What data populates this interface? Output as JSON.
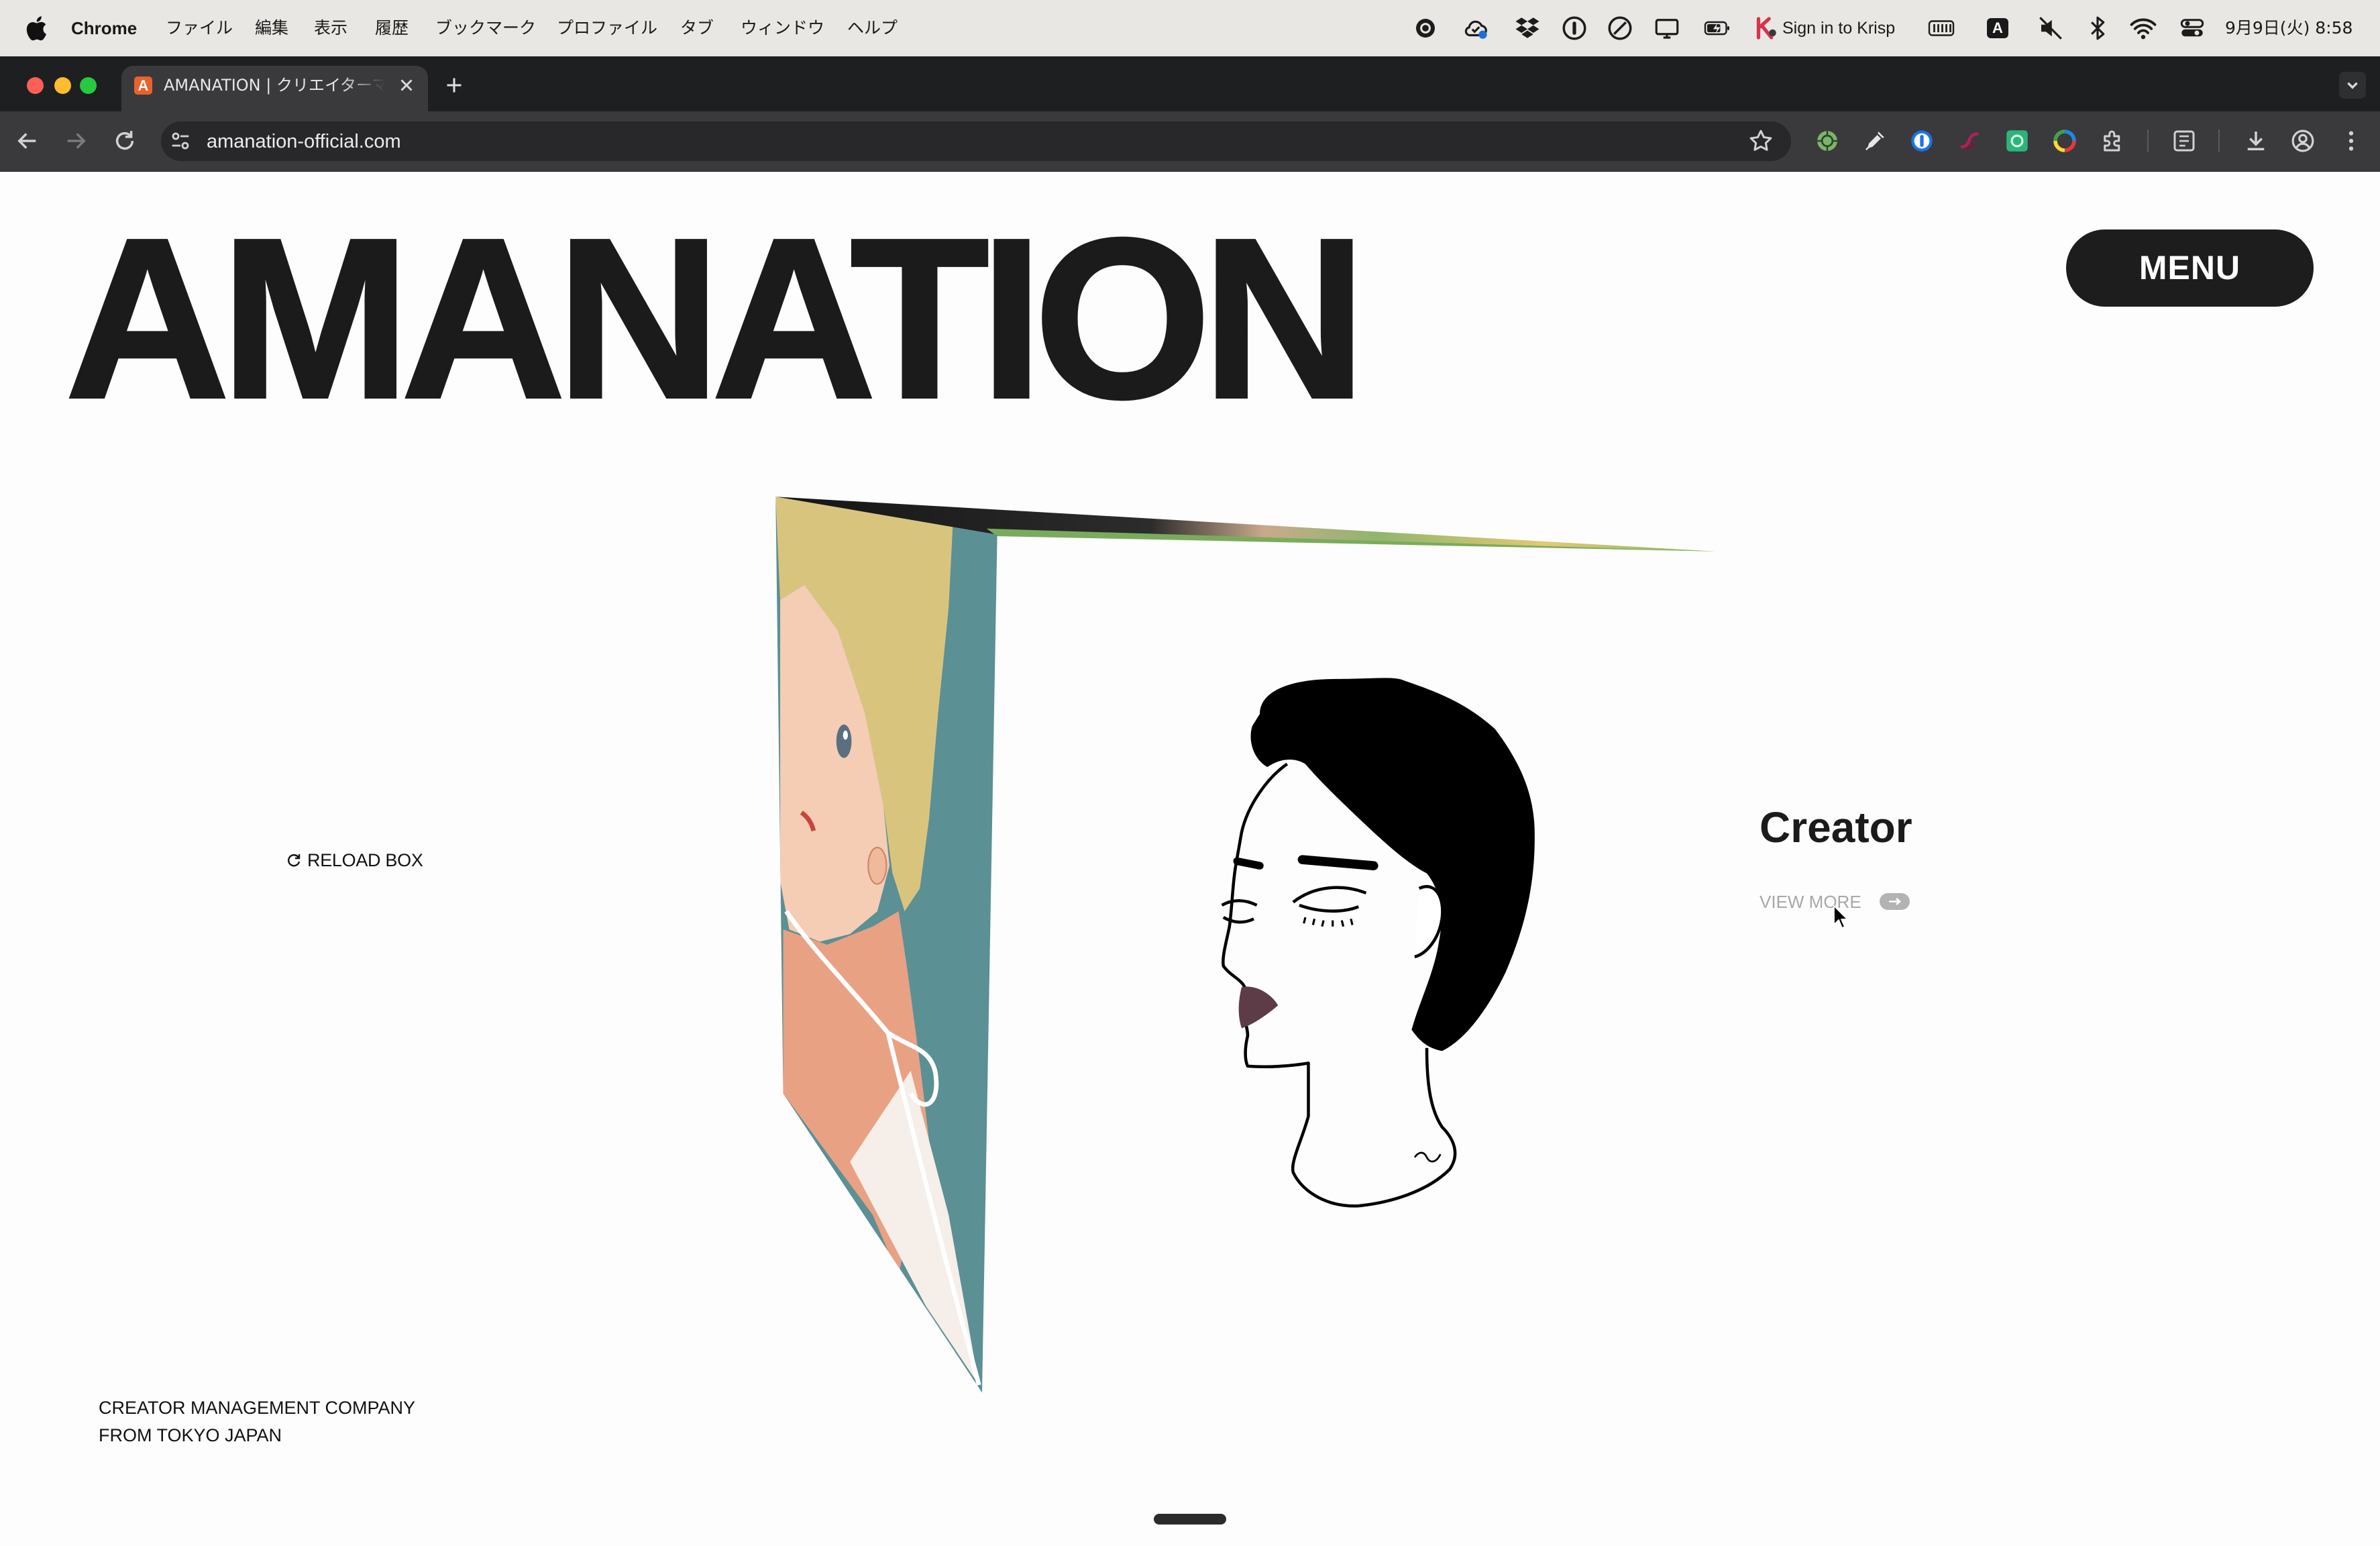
{
  "menubar": {
    "app_name": "Chrome",
    "items": [
      "ファイル",
      "編集",
      "表示",
      "履歴",
      "ブックマーク",
      "プロファイル",
      "タブ",
      "ウィンドウ",
      "ヘルプ"
    ],
    "krisp_label": "Sign in to Krisp",
    "input_source": "A",
    "clock": "9月9日(火) 8:58",
    "status_icons": [
      "screen-record-icon",
      "cloud-sync-icon",
      "dropbox-icon",
      "password-manager-icon",
      "focus-icon",
      "display-icon",
      "battery-charging-icon",
      "krisp-icon",
      "battery-bars-icon",
      "input-source-icon",
      "volume-muted-icon",
      "bluetooth-icon",
      "wifi-icon",
      "control-center-icon"
    ]
  },
  "browser": {
    "tab": {
      "favicon_letter": "A",
      "title": "AMANATION | クリエイターマ"
    },
    "url": "amanation-official.com",
    "toolbar_icons": [
      "back-icon",
      "forward-icon",
      "reload-icon",
      "site-info-icon",
      "bookmark-star-icon",
      "side-panel-icon",
      "download-icon",
      "profile-icon",
      "more-menu-icon"
    ],
    "extension_icons": [
      "green-extension-icon",
      "eyedropper-icon",
      "password-extension-icon",
      "pink-swirl-extension-icon",
      "green-square-extension-icon",
      "rainbow-circle-extension-icon",
      "extensions-puzzle-icon"
    ]
  },
  "page": {
    "logo": "AMANATION",
    "menu_button": "MENU",
    "reload_label": "RELOAD BOX",
    "featured_category": "Creator",
    "view_more": "VIEW MORE",
    "tagline": [
      "CREATOR MANAGEMENT COMPANY",
      "FROM TOKYO JAPAN"
    ]
  },
  "colors": {
    "menubar_bg": "#e9e7e3",
    "tabstrip_bg": "#1e1f21",
    "toolbar_bg": "#3a3a3c",
    "omnibox_bg": "#28282a",
    "page_bg": "#fdfdfd",
    "ink": "#1b1b1b",
    "menu_button_bg": "#1d1d1d",
    "muted_text": "#a8a8a8",
    "favicon_bg": "#e8622c",
    "illustration_teal": "#5b9095",
    "illustration_hair": "#d9c47e"
  }
}
